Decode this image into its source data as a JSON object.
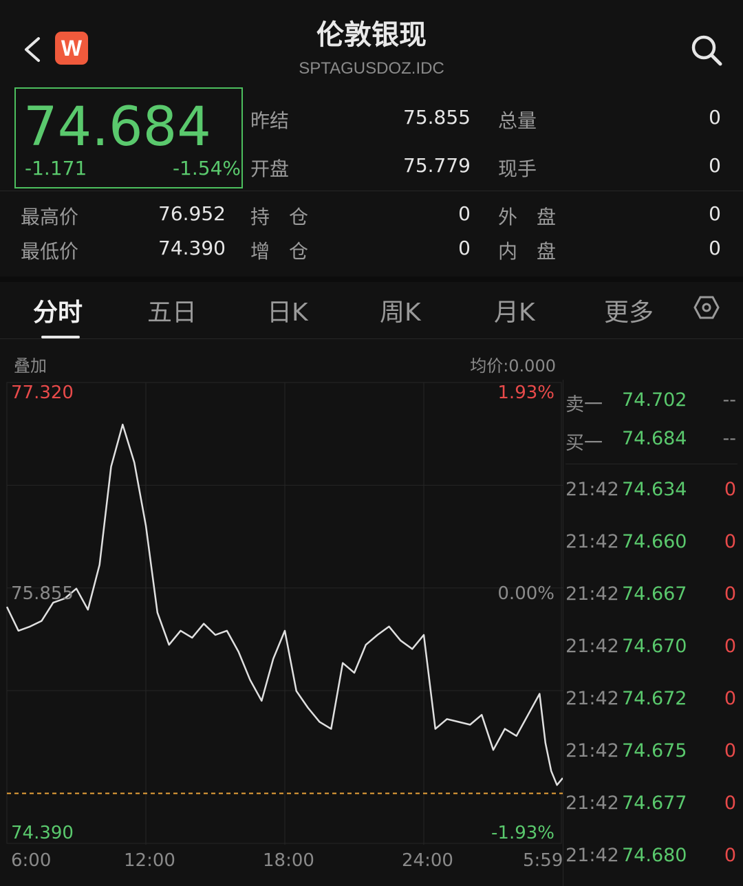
{
  "header": {
    "title": "伦敦银现",
    "symbol": "SPTAGUSDOZ.IDC"
  },
  "quote": {
    "price": "74.684",
    "change": "-1.171",
    "change_pct": "-1.54%"
  },
  "stats": [
    {
      "label": "昨结",
      "value": "75.855"
    },
    {
      "label": "总量",
      "value": "0"
    },
    {
      "label": "开盘",
      "value": "75.779"
    },
    {
      "label": "现手",
      "value": "0"
    },
    {
      "label": "最高价",
      "value": "76.952"
    },
    {
      "label": "持　仓",
      "value": "0"
    },
    {
      "label": "外　盘",
      "value": "0"
    },
    {
      "label": "最低价",
      "value": "74.390"
    },
    {
      "label": "增　仓",
      "value": "0"
    },
    {
      "label": "内　盘",
      "value": "0"
    }
  ],
  "tabs": [
    "分时",
    "五日",
    "日K",
    "周K",
    "月K",
    "更多"
  ],
  "overlay_label": "叠加",
  "avg_price": "均价:0.000",
  "chart_data": {
    "type": "line",
    "ylim": [
      74.39,
      77.32
    ],
    "y_labels": {
      "top": "77.320",
      "mid": "75.855",
      "bottom": "74.390"
    },
    "pct_labels": {
      "top": "1.93%",
      "mid": "0.00%",
      "bottom": "-1.93%"
    },
    "x_ticks": [
      "6:00",
      "12:00",
      "18:00",
      "24:00",
      "5:59"
    ],
    "ref_line": 74.39,
    "x": [
      0,
      0.5,
      1,
      1.5,
      2,
      2.5,
      3,
      3.5,
      4,
      4.5,
      5,
      5.5,
      6,
      6.5,
      7,
      7.5,
      8,
      8.5,
      9,
      9.5,
      10,
      10.5,
      11,
      11.5,
      12,
      12.5,
      13,
      13.5,
      14,
      14.5,
      15,
      15.5,
      16,
      16.5,
      17,
      17.5,
      18,
      18.5,
      19,
      19.5,
      20,
      20.5,
      21,
      21.5,
      22,
      22.5,
      23,
      23.25,
      23.5,
      23.75,
      24
    ],
    "values": [
      75.72,
      75.55,
      75.58,
      75.62,
      75.75,
      75.78,
      75.85,
      75.7,
      76.02,
      76.72,
      77.02,
      76.75,
      76.3,
      75.68,
      75.45,
      75.55,
      75.5,
      75.6,
      75.52,
      75.55,
      75.4,
      75.2,
      75.05,
      75.35,
      75.55,
      75.12,
      75.0,
      74.9,
      74.85,
      75.32,
      75.25,
      75.45,
      75.52,
      75.58,
      75.48,
      75.42,
      75.52,
      74.85,
      74.92,
      74.9,
      74.88,
      74.95,
      74.7,
      74.85,
      74.8,
      74.95,
      75.1,
      74.75,
      74.55,
      74.45,
      74.5
    ]
  },
  "orderbook": {
    "ask": {
      "label": "卖一",
      "price": "74.702",
      "vol": "--"
    },
    "bid": {
      "label": "买一",
      "price": "74.684",
      "vol": "--"
    },
    "ticks": [
      {
        "time": "21:42",
        "price": "74.634",
        "vol": "0"
      },
      {
        "time": "21:42",
        "price": "74.660",
        "vol": "0"
      },
      {
        "time": "21:42",
        "price": "74.667",
        "vol": "0"
      },
      {
        "time": "21:42",
        "price": "74.670",
        "vol": "0"
      },
      {
        "time": "21:42",
        "price": "74.672",
        "vol": "0"
      },
      {
        "time": "21:42",
        "price": "74.675",
        "vol": "0"
      },
      {
        "time": "21:42",
        "price": "74.677",
        "vol": "0"
      },
      {
        "time": "21:42",
        "price": "74.680",
        "vol": "0"
      }
    ]
  },
  "colors": {
    "up": "#e84a4a",
    "down": "#5ac96d",
    "line": "#e0e0e0",
    "ref": "#e8a23a"
  }
}
